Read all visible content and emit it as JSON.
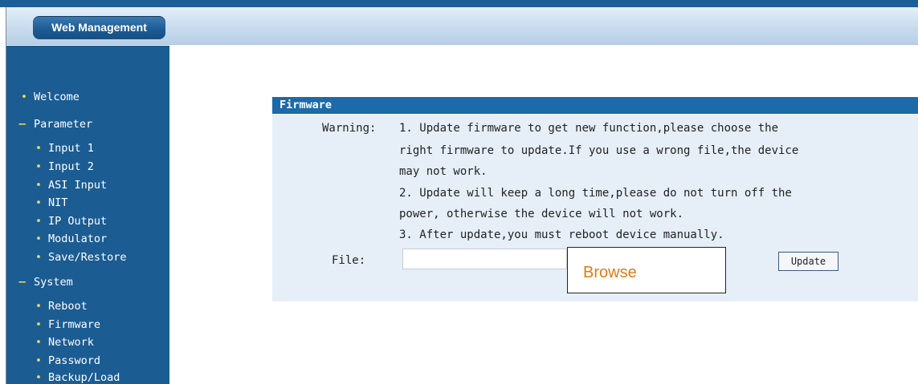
{
  "header": {
    "tab_label": "Web Management"
  },
  "sidebar": {
    "items": [
      {
        "label": "Welcome",
        "type": "link"
      },
      {
        "label": "Parameter",
        "type": "section"
      },
      {
        "label": "Input 1",
        "type": "sub"
      },
      {
        "label": "Input 2",
        "type": "sub"
      },
      {
        "label": "ASI Input",
        "type": "sub"
      },
      {
        "label": "NIT",
        "type": "sub"
      },
      {
        "label": "IP Output",
        "type": "sub"
      },
      {
        "label": "Modulator",
        "type": "sub"
      },
      {
        "label": "Save/Restore",
        "type": "sub"
      },
      {
        "label": "System",
        "type": "section"
      },
      {
        "label": "Reboot",
        "type": "sub"
      },
      {
        "label": "Firmware",
        "type": "sub"
      },
      {
        "label": "Network",
        "type": "sub"
      },
      {
        "label": "Password",
        "type": "sub"
      },
      {
        "label": "Backup/Load",
        "type": "sub"
      }
    ],
    "bullet_glyph": "•",
    "section_glyph": "−"
  },
  "panel": {
    "title": "Firmware",
    "warning_label": "Warning:",
    "warning_lines": [
      "1. Update firmware to get new function,please choose the",
      "right firmware to update.If you use a wrong file,the device",
      "may not work.",
      "2. Update will keep a long time,please do not turn off the",
      "power, otherwise the device will not work.",
      "3. After update,you must reboot device manually."
    ],
    "file_label": "File:",
    "file_value": "",
    "browse_label": "Browse",
    "update_label": "Update"
  },
  "colors": {
    "brand_blue": "#1b5c93",
    "panel_header": "#1c6aa9",
    "panel_body": "#e6eff8",
    "bullet": "#f5d54a",
    "browse_text": "#e27a13"
  }
}
